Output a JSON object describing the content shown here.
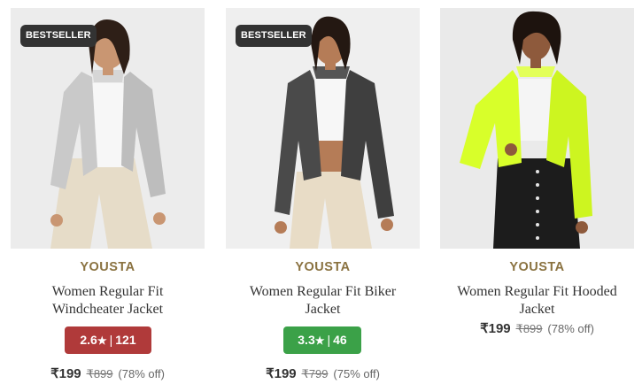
{
  "products": [
    {
      "badge": "BESTSELLER",
      "brand": "YOUSTA",
      "name_line1": "Women Regular Fit",
      "name_line2": "Windcheater Jacket",
      "rating_value": "2.6",
      "rating_count": "121",
      "rating_color": "#b03a3a",
      "price": "₹199",
      "mrp": "₹899",
      "discount": "(78% off)",
      "jacket_color": "#c9c9c9"
    },
    {
      "badge": "BESTSELLER",
      "brand": "YOUSTA",
      "name_line1": "Women Regular Fit Biker",
      "name_line2": "Jacket",
      "rating_value": "3.3",
      "rating_count": "46",
      "rating_color": "#3ba148",
      "price": "₹199",
      "mrp": "₹799",
      "discount": "(75% off)",
      "jacket_color": "#4a4a4a"
    },
    {
      "brand": "YOUSTA",
      "name_line1": "Women Regular Fit Hooded",
      "name_line2": "Jacket",
      "price": "₹199",
      "mrp": "₹899",
      "discount": "(78% off)",
      "jacket_color": "#d8ff2a"
    }
  ],
  "icons": {
    "rating": "star-icon"
  },
  "colors": {
    "brand_text": "#8a7240",
    "badge_bg": "#333333"
  }
}
